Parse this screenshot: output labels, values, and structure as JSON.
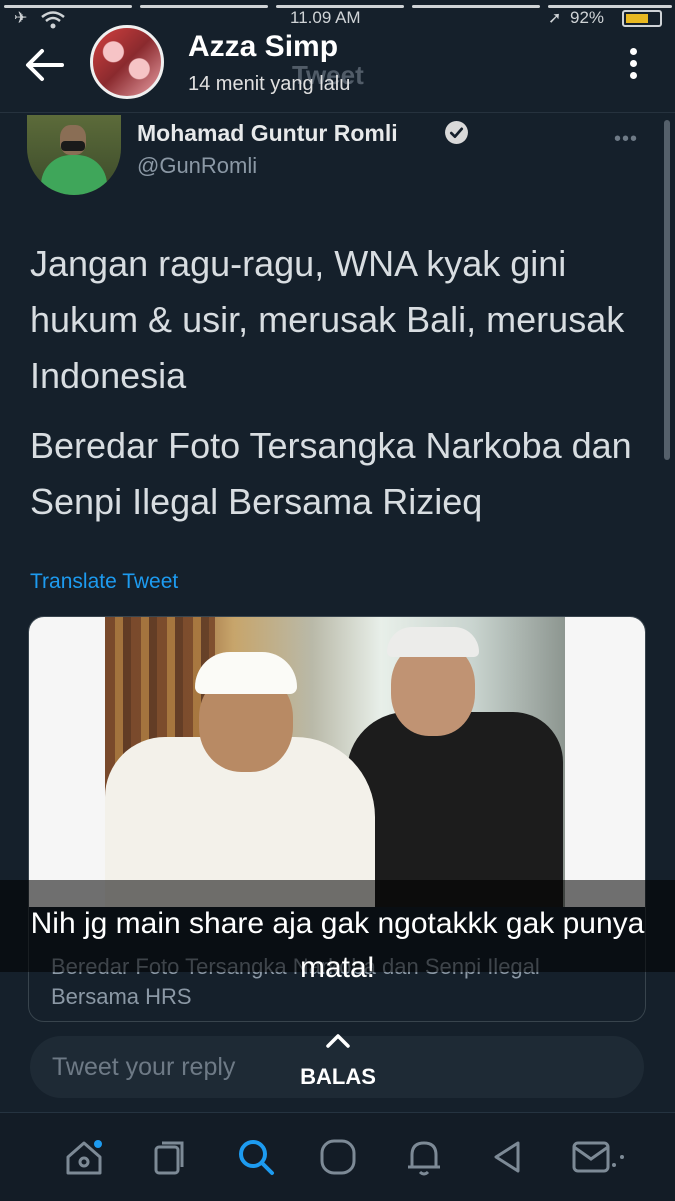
{
  "status_bar": {
    "time": "11.09 AM",
    "battery": "92%",
    "battery_color": "#e8b820"
  },
  "story": {
    "name": "Azza Simp",
    "time_ago": "14 menit yang lalu",
    "ghost_header": "Tweet",
    "caption": "Nih jg main share aja gak ngotakkk gak punya mata!",
    "reply_label": "BALAS"
  },
  "tweet": {
    "author_name": "Mohamad Guntur Romli",
    "handle": "@GunRomli",
    "more": "•••",
    "body_p1": "Jangan ragu-ragu, WNA kyak gini hukum & usir, merusak Bali, merusak Indonesia",
    "body_p2": "Beredar Foto Tersangka Narkoba dan Senpi Ilegal Bersama Rizieq",
    "translate": "Translate Tweet",
    "card_text": "Beredar Foto Tersangka Narkoba dan Senpi Ilegal Bersama HRS"
  },
  "reply": {
    "placeholder": "Tweet your reply"
  },
  "colors": {
    "background": "#15202b",
    "accent": "#1d9bf0",
    "muted": "#8b98a5"
  },
  "nav_icons": [
    "home-icon",
    "topics-icon",
    "search-icon",
    "spaces-icon",
    "notifications-icon",
    "back-triangle-icon",
    "messages-icon"
  ]
}
